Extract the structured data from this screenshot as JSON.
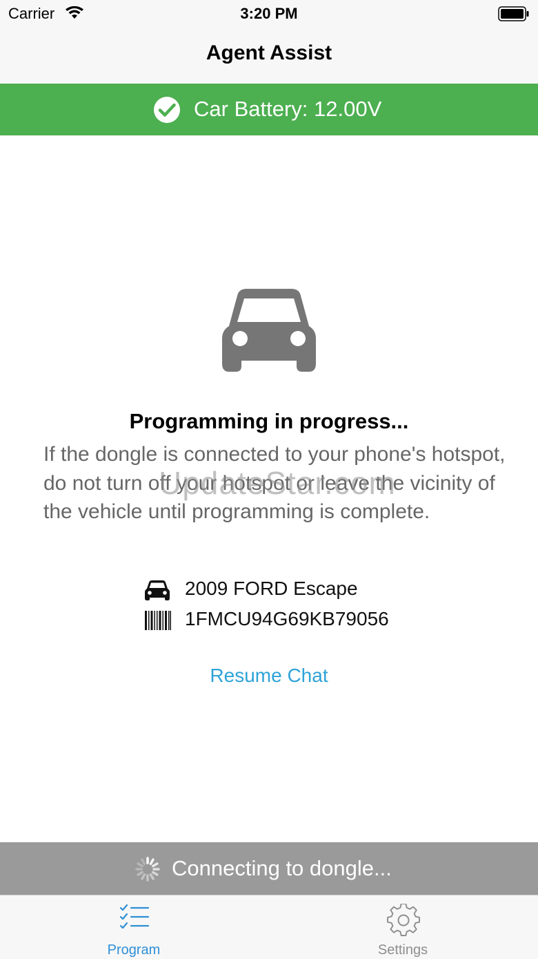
{
  "status_bar": {
    "carrier": "Carrier",
    "time": "3:20 PM"
  },
  "nav": {
    "title": "Agent Assist"
  },
  "battery_banner": {
    "text": "Car Battery: 12.00V",
    "color": "#4caf50"
  },
  "main": {
    "title": "Programming in progress...",
    "description": "If the dongle is connected to your phone's hotspot, do not turn off your hotspot or leave the vicinity of the vehicle until programming is complete.",
    "watermark": "UpdateStar.com",
    "vehicle": "2009 FORD Escape",
    "vin": "1FMCU94G69KB79056",
    "resume_chat": "Resume Chat"
  },
  "connection": {
    "status": "Connecting to dongle..."
  },
  "tabs": [
    {
      "label": "Program",
      "icon": "checklist-icon",
      "active": true
    },
    {
      "label": "Settings",
      "icon": "gear-icon",
      "active": false
    }
  ],
  "colors": {
    "accent": "#2e8fd6",
    "link": "#2ea3d8",
    "banner_gray": "#9a9a9a"
  }
}
